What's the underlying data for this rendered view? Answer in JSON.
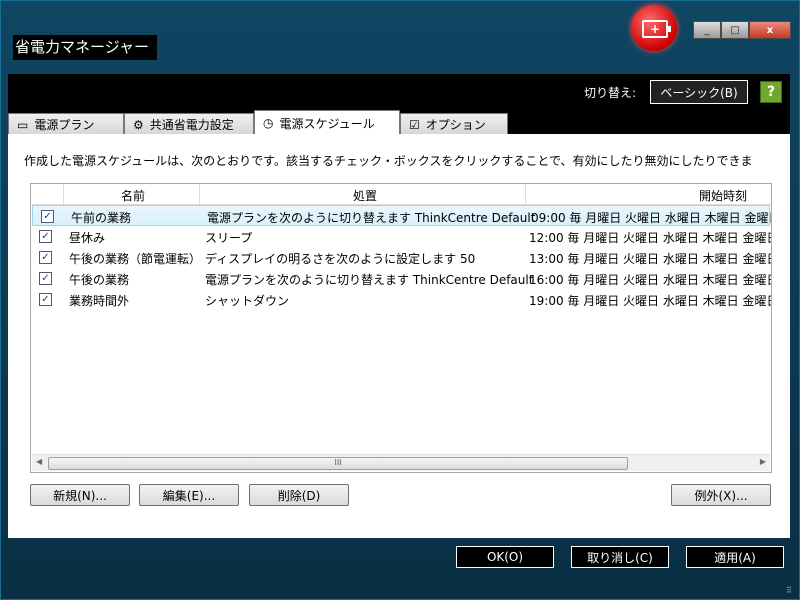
{
  "window": {
    "title": "省電力マネージャー",
    "controls": [
      "_",
      "□",
      "x"
    ]
  },
  "header": {
    "switch_label": "切り替え:",
    "basic_button": "ベーシック(B)"
  },
  "tabs": [
    {
      "label": "電源プラン",
      "icon": "document-icon"
    },
    {
      "label": "共通省電力設定",
      "icon": "gear-icon"
    },
    {
      "label": "電源スケジュール",
      "icon": "clock-icon"
    },
    {
      "label": "オプション",
      "icon": "checkbox-icon"
    }
  ],
  "main": {
    "description": "作成した電源スケジュールは、次のとおりです。該当するチェック・ボックスをクリックすることで、有効にしたり無効にしたりできま",
    "columns": [
      "名前",
      "処置",
      "開始時刻"
    ],
    "rows": [
      {
        "name": "午前の業務",
        "action": "電源プランを次のように切り替えます ThinkCentre Default",
        "start": "09:00 毎 月曜日 火曜日 水曜日 木曜日 金曜日"
      },
      {
        "name": "昼休み",
        "action": "スリープ",
        "start": "12:00 毎 月曜日 火曜日 水曜日 木曜日 金曜日"
      },
      {
        "name": "午後の業務（節電運転）",
        "action": "ディスプレイの明るさを次のように設定します 50",
        "start": "13:00 毎 月曜日 火曜日 水曜日 木曜日 金曜日"
      },
      {
        "name": "午後の業務",
        "action": "電源プランを次のように切り替えます ThinkCentre Default",
        "start": "16:00 毎 月曜日 火曜日 水曜日 木曜日 金曜日"
      },
      {
        "name": "業務時間外",
        "action": "シャットダウン",
        "start": "19:00 毎 月曜日 火曜日 水曜日 木曜日 金曜日"
      }
    ],
    "scroll_thumb": "III",
    "buttons": {
      "new": "新規(N)...",
      "edit": "編集(E)...",
      "delete": "削除(D)",
      "exceptions": "例外(X)..."
    }
  },
  "footer": {
    "ok": "OK(O)",
    "cancel": "取り消し(C)",
    "apply": "適用(A)"
  }
}
